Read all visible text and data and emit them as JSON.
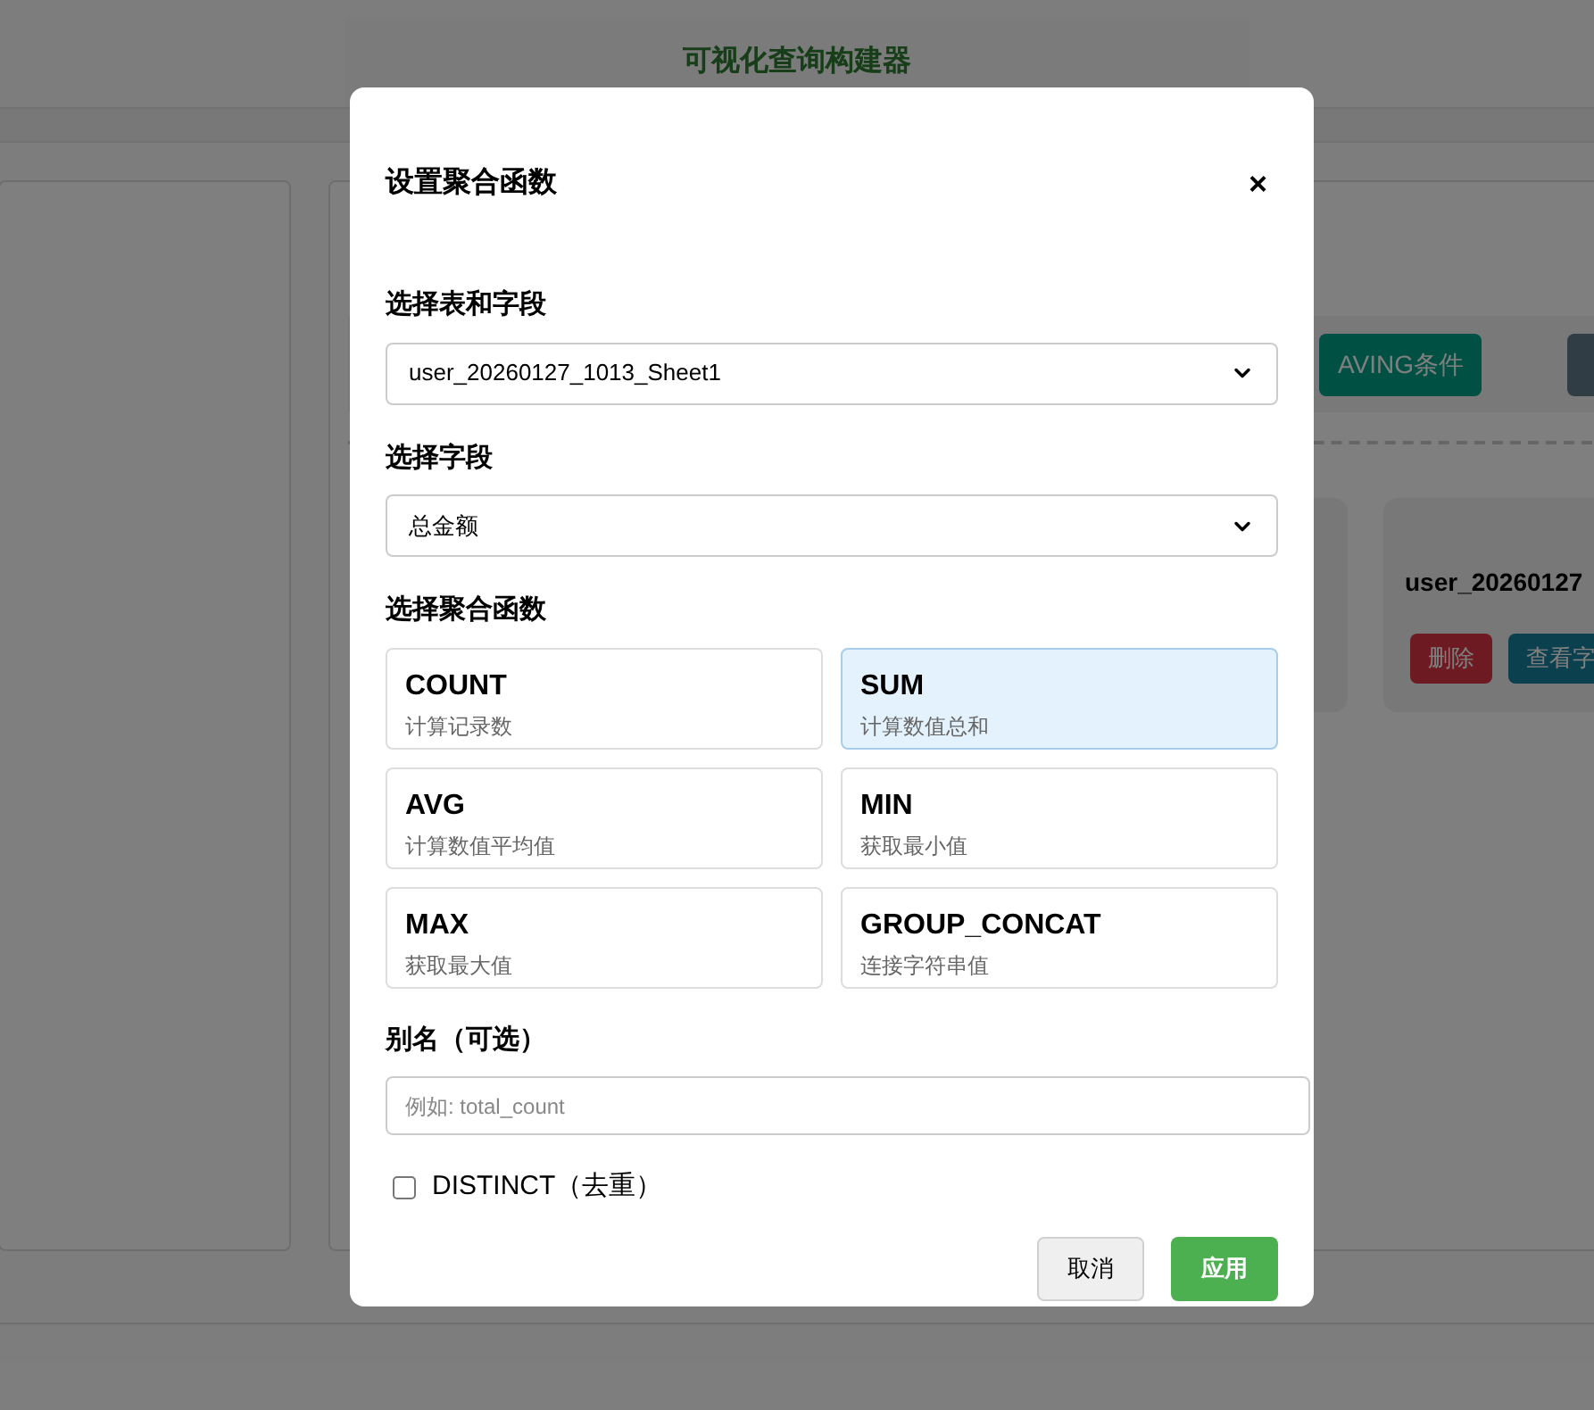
{
  "background": {
    "title": "可视化查询构建器",
    "toolbar_buttons": [
      {
        "kind": "text",
        "label": "AVING条件"
      },
      {
        "kind": "icon"
      }
    ],
    "table_card": {
      "name": "user_20260127",
      "actions": [
        {
          "label": "删除",
          "kind": "danger"
        },
        {
          "label": "查看字",
          "kind": "info"
        }
      ]
    }
  },
  "dialog": {
    "title": "设置聚合函数",
    "close": "×",
    "table_label": "选择表和字段",
    "table_value": "user_20260127_1013_Sheet1",
    "field_label": "选择字段",
    "field_value": "总金额",
    "function_label": "选择聚合函数",
    "functions": [
      {
        "name": "COUNT",
        "description": "计算记录数",
        "selected": false
      },
      {
        "name": "SUM",
        "description": "计算数值总和",
        "selected": true
      },
      {
        "name": "AVG",
        "description": "计算数值平均值",
        "selected": false
      },
      {
        "name": "MIN",
        "description": "获取最小值",
        "selected": false
      },
      {
        "name": "MAX",
        "description": "获取最大值",
        "selected": false
      },
      {
        "name": "GROUP_CONCAT",
        "description": "连接字符串值",
        "selected": false
      }
    ],
    "alias_label": "别名（可选）",
    "alias": {
      "placeholder": "例如: total_count"
    },
    "distinct": {
      "label": "DISTINCT（去重）",
      "checked": false
    },
    "buttons": [
      {
        "label": "取消",
        "kind": "secondary"
      },
      {
        "label": "应用",
        "kind": "primary"
      }
    ]
  }
}
